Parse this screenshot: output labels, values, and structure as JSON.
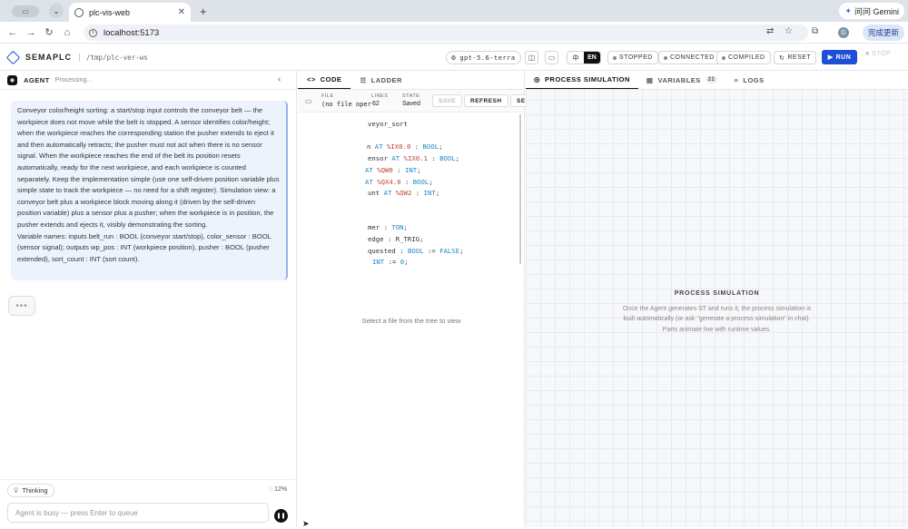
{
  "browser": {
    "tab_title": "plc-vis-web",
    "url": "localhost:5173",
    "gemini_label": "问问 Gemini",
    "update_label": "完成更新",
    "avatar_initial": "G"
  },
  "app": {
    "brand": "SEMAPLC",
    "path": "/tmp/plc-ver-ws",
    "model": "gpt-5.6-terra",
    "lang_zh": "中",
    "lang_en": "EN",
    "status_stopped": "STOPPED",
    "status_connected": "CONNECTED",
    "status_compiled": "COMPILED",
    "reset": "RESET",
    "run": "RUN",
    "stop": "STOP"
  },
  "agent": {
    "title": "AGENT",
    "status": "Processing…",
    "message": "Conveyor color/height sorting: a start/stop input controls the conveyor belt — the workpiece does not move while the belt is stopped. A sensor identifies color/height; when the workpiece reaches the corresponding station the pusher extends to eject it and then automatically retracts; the pusher must not act when there is no sensor signal. When the workpiece reaches the end of the belt its position resets automatically, ready for the next workpiece, and each workpiece is counted separately. Keep the implementation simple (use one self-driven position variable plus simple state to track the workpiece — no need for a shift register). Simulation view: a conveyor belt plus a workpiece block moving along it (driven by the self-driven position variable) plus a sensor plus a pusher; when the workpiece is in position, the pusher extends and ejects it, visibly demonstrating the sorting.\nVariable names: inputs belt_run : BOOL (conveyor start/stop), color_sensor : BOOL (sensor signal); outputs wp_pos : INT (workpiece position), pusher : BOOL (pusher extended), sort_count : INT (sort count).",
    "thinking_label": "Thinking",
    "progress": "12%",
    "input_placeholder": "Agent is busy — press Enter to queue"
  },
  "code_panel": {
    "tab_code": "CODE",
    "tab_ladder": "LADDER",
    "file_label": "FILE",
    "file_value": "(no file oper",
    "lines_label": "LINES",
    "lines_value": "62",
    "state_label": "STATE",
    "state_value": "Saved",
    "save": "SAVE",
    "refresh": "REFRESH",
    "more": "SE",
    "select_msg": "Select a file from the tree to view",
    "code_lines": [
      [
        {
          "t": "veyor_sort",
          "c": ""
        }
      ],
      [],
      [
        {
          "t": "n ",
          "c": ""
        },
        {
          "t": "AT ",
          "c": "kw"
        },
        {
          "t": "%IX0.0",
          "c": "addr2"
        },
        {
          "t": " : ",
          "c": ""
        },
        {
          "t": "BOOL",
          "c": "kw"
        },
        {
          "t": ";",
          "c": ""
        }
      ],
      [
        {
          "t": "ensor ",
          "c": ""
        },
        {
          "t": "AT ",
          "c": "kw"
        },
        {
          "t": "%IX0.1",
          "c": "addr2"
        },
        {
          "t": " : ",
          "c": ""
        },
        {
          "t": "BOOL",
          "c": "kw"
        },
        {
          "t": ";",
          "c": ""
        }
      ],
      [
        {
          "t": "AT ",
          "c": "kw"
        },
        {
          "t": "%QW0",
          "c": "addr2"
        },
        {
          "t": " : ",
          "c": ""
        },
        {
          "t": "INT",
          "c": "kw"
        },
        {
          "t": ";",
          "c": ""
        }
      ],
      [
        {
          "t": "AT ",
          "c": "kw"
        },
        {
          "t": "%QX4.0",
          "c": "addr2"
        },
        {
          "t": " : ",
          "c": ""
        },
        {
          "t": "BOOL",
          "c": "kw"
        },
        {
          "t": ";",
          "c": ""
        }
      ],
      [
        {
          "t": "unt ",
          "c": ""
        },
        {
          "t": "AT ",
          "c": "kw"
        },
        {
          "t": "%QW2",
          "c": "addr2"
        },
        {
          "t": " : ",
          "c": ""
        },
        {
          "t": "INT",
          "c": "kw"
        },
        {
          "t": ";",
          "c": ""
        }
      ],
      [],
      [],
      [
        {
          "t": "mer : ",
          "c": ""
        },
        {
          "t": "TON",
          "c": "kw"
        },
        {
          "t": ";",
          "c": ""
        }
      ],
      [
        {
          "t": "edge : R_TRIG;",
          "c": ""
        }
      ],
      [
        {
          "t": "quested : ",
          "c": ""
        },
        {
          "t": "BOOL",
          "c": "kw"
        },
        {
          "t": " := ",
          "c": ""
        },
        {
          "t": "FALSE",
          "c": "kw"
        },
        {
          "t": ";",
          "c": ""
        }
      ],
      [
        {
          "t": "INT",
          "c": "kw"
        },
        {
          "t": " := ",
          "c": ""
        },
        {
          "t": "0",
          "c": "kw"
        },
        {
          "t": ";",
          "c": ""
        }
      ]
    ]
  },
  "sim_panel": {
    "tab_sim": "PROCESS SIMULATION",
    "tab_vars": "VARIABLES",
    "vars_count": "22",
    "tab_logs": "LOGS",
    "title": "PROCESS SIMULATION",
    "description": "Once the Agent generates ST and runs it, the process simulation is built automatically (or ask \"generate a process simulation\" in chat). Parts animate live with runtime values."
  }
}
